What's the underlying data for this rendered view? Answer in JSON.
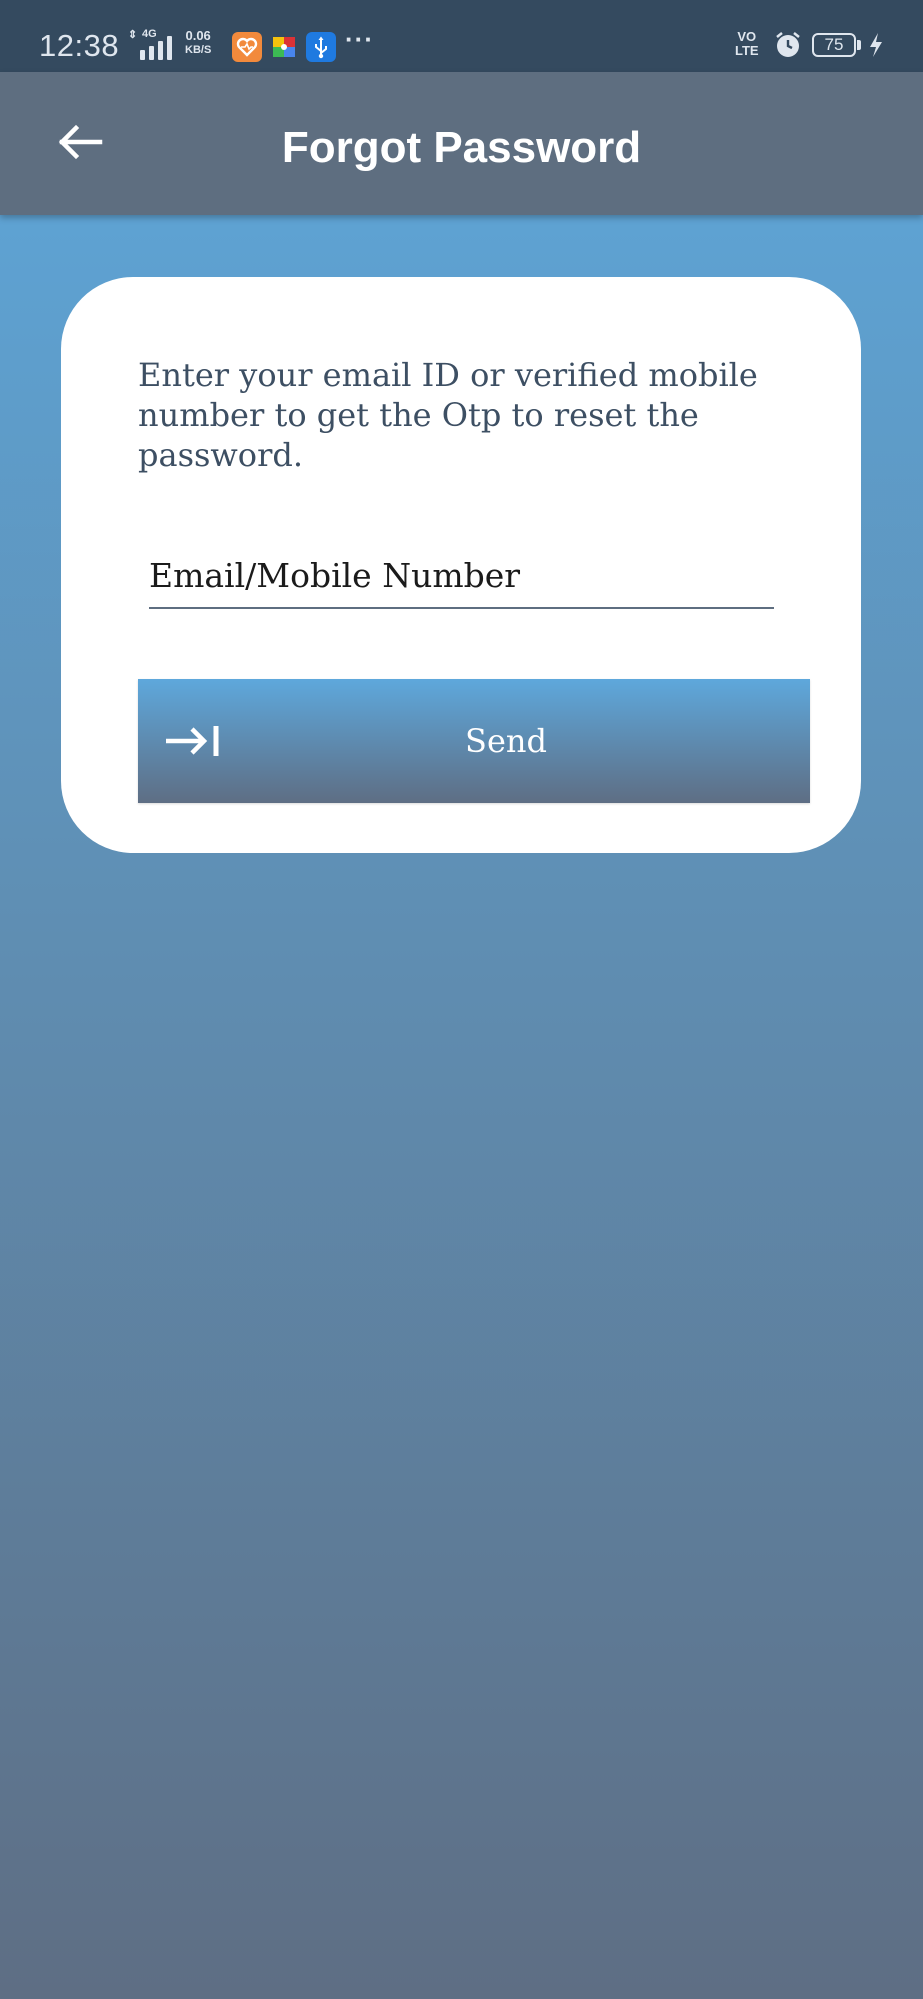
{
  "status_bar": {
    "time": "12:38",
    "network_type": "4G",
    "speed_value": "0.06",
    "speed_unit": "KB/S",
    "volte_top": "VO",
    "volte_bottom": "LTE",
    "battery_level": "75",
    "overflow": "···",
    "icons": [
      "arrows-updown-icon",
      "signal-bars-icon",
      "health-app-icon",
      "puzzle-app-icon",
      "usb-icon",
      "alarm-icon",
      "battery-icon",
      "charging-bolt-icon"
    ]
  },
  "app_bar": {
    "title": "Forgot Password",
    "back_icon": "arrow-left-icon"
  },
  "form": {
    "instructions": "Enter your email ID or verified mobile number to get the Otp to reset the password.",
    "input_placeholder": "Email/Mobile Number",
    "input_value": "",
    "send_label": "Send",
    "send_icon": "arrow-to-bar-icon"
  },
  "colors": {
    "status_bar_bg": "#344a5f",
    "app_bar_bg": "#5e6e80",
    "gradient_top": "#5ea8dc",
    "gradient_bottom": "#5e6e84",
    "card_bg": "#ffffff",
    "text_primary": "#3d4f63"
  }
}
